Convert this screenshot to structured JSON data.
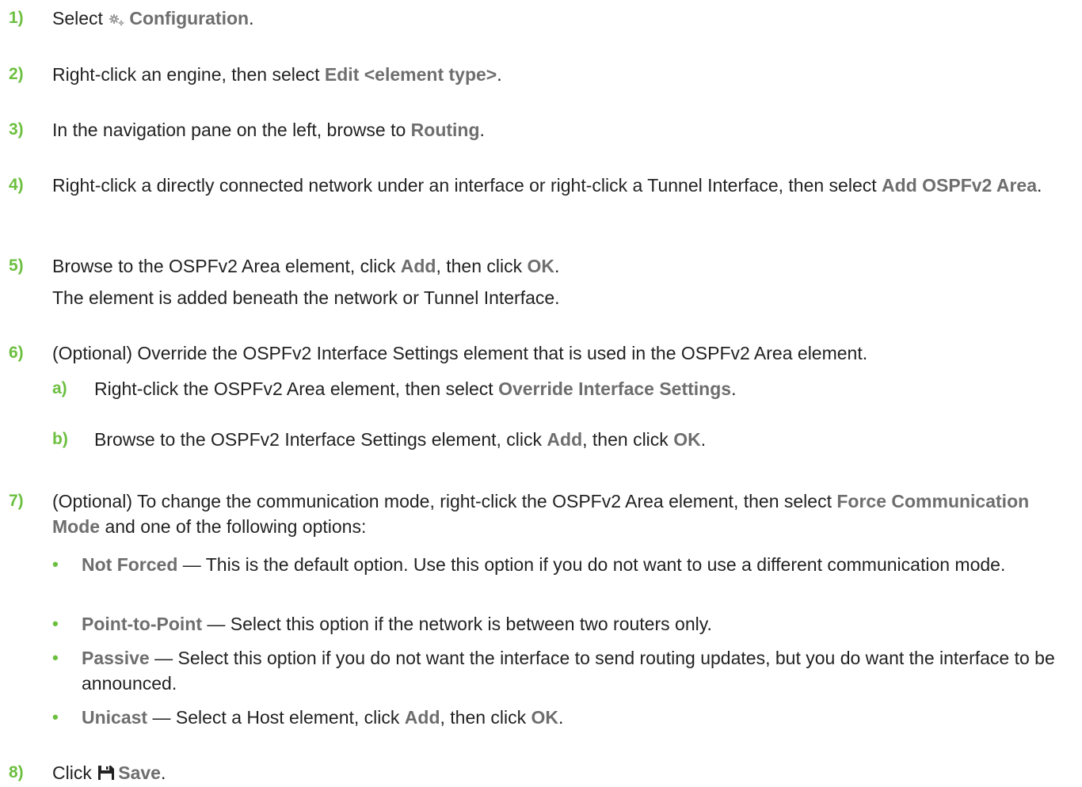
{
  "colors": {
    "number": "#6cbf3f",
    "bold_text": "#6e6e6e",
    "text": "#222222"
  },
  "steps": [
    {
      "num": "1)",
      "pre": "Select",
      "icon": "gears-icon",
      "bold": "Configuration",
      "post": "."
    },
    {
      "num": "2)",
      "pre": "Right-click an engine, then select ",
      "bold": "Edit <element type>",
      "post": "."
    },
    {
      "num": "3)",
      "pre": "In the navigation pane on the left, browse to ",
      "bold": "Routing",
      "post": "."
    },
    {
      "num": "4)",
      "pre": "Right-click a directly connected network under an interface or right-click a Tunnel Interface, then select ",
      "bold": "Add OSPFv2 Area",
      "post": "."
    },
    {
      "num": "5)",
      "pre": "Browse to the OSPFv2 Area element, click ",
      "bold": "Add",
      "mid": ", then click ",
      "bold2": "OK",
      "post": ".",
      "result": "The element is added beneath the network or Tunnel Interface."
    },
    {
      "num": "6)",
      "text": "(Optional) Override the OSPFv2 Interface Settings element that is used in the OSPFv2 Area element.",
      "substeps": [
        {
          "num": "a)",
          "pre": "Right-click the OSPFv2 Area element, then select ",
          "bold": "Override Interface Settings",
          "post": "."
        },
        {
          "num": "b)",
          "pre": "Browse to the OSPFv2 Interface Settings element, click ",
          "bold": "Add",
          "mid": ", then click ",
          "bold2": "OK",
          "post": "."
        }
      ]
    },
    {
      "num": "7)",
      "pre": "(Optional) To change the communication mode, right-click the OSPFv2 Area element, then select ",
      "bold": "Force Communication Mode",
      "post": " and one of the following options:",
      "bullets": [
        {
          "bold": "Not Forced",
          "text": " — This is the default option. Use this option if you do not want to use a different communication mode."
        },
        {
          "bold": "Point-to-Point",
          "text": " — Select this option if the network is between two routers only."
        },
        {
          "bold": "Passive",
          "text": " — Select this option if you do not want the interface to send routing updates, but you do want the interface to be announced."
        },
        {
          "bold": "Unicast",
          "text": " — Select a Host element, click ",
          "bold2": "Add",
          "mid": ", then click ",
          "bold3": "OK",
          "post": "."
        }
      ]
    },
    {
      "num": "8)",
      "pre": "Click",
      "icon": "save-icon",
      "bold": "Save",
      "post": "."
    }
  ]
}
